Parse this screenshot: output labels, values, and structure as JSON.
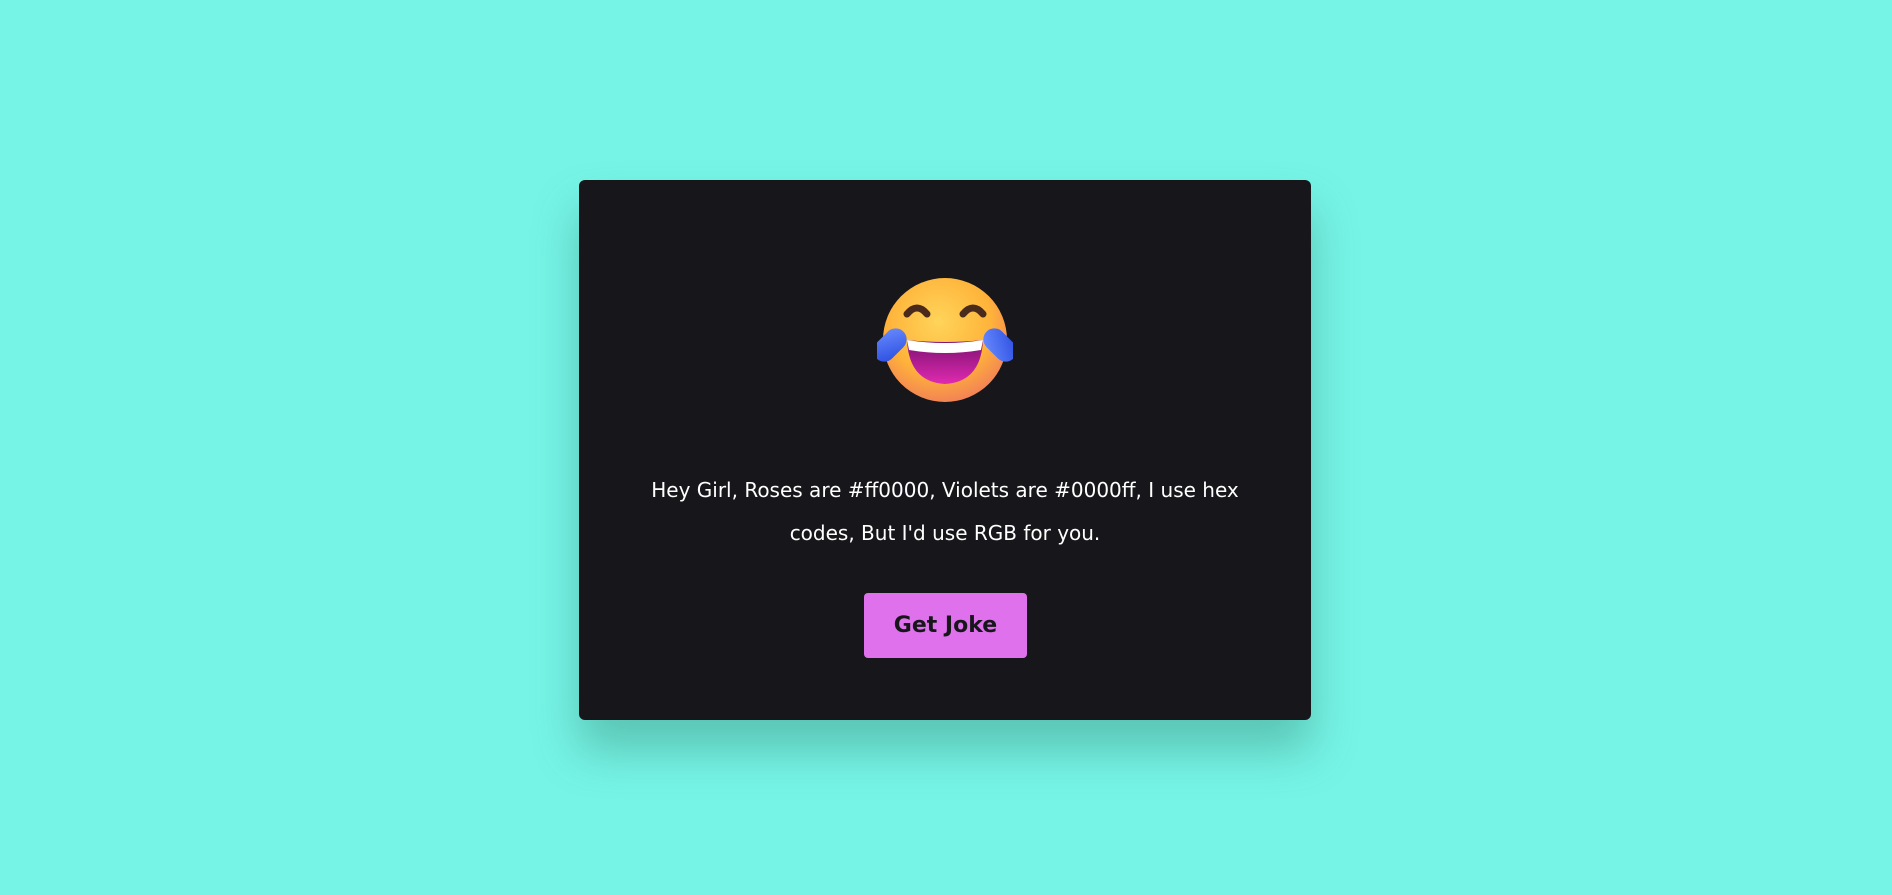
{
  "page": {
    "background_color": "#76f4e6"
  },
  "card": {
    "background_color": "#17171b",
    "emoji_icon": "face-with-tears-of-joy-icon",
    "joke_text": "Hey Girl, Roses are #ff0000, Violets are #0000ff, I use hex codes, But I'd use RGB for you.",
    "button_label": "Get Joke",
    "button_color": "#df72ec"
  }
}
